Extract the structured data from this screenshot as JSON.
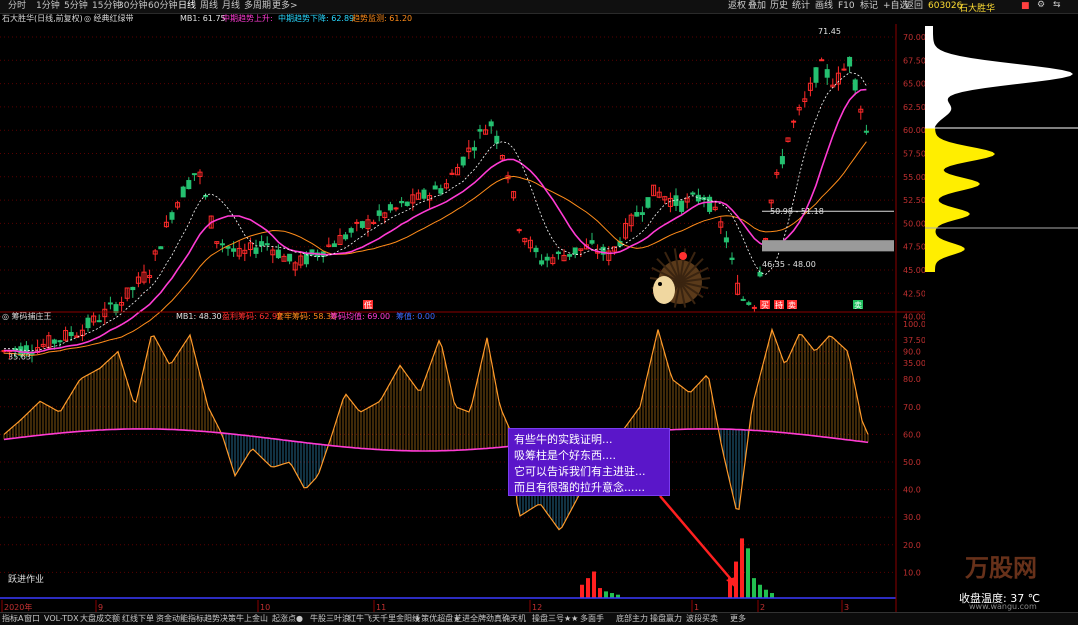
{
  "periods": [
    "分时",
    "1分钟",
    "5分钟",
    "15分钟",
    "30分钟",
    "60分钟",
    "日线",
    "周线",
    "月线",
    "多周期",
    "更多>"
  ],
  "active_period": "日线",
  "right_buttons": [
    "返权",
    "叠加",
    "历史",
    "统计",
    "画线",
    "F10",
    "标记",
    "+自选",
    "返回"
  ],
  "header": {
    "stock": "石大胜华(日线,前复权)",
    "indicator": "◎ 经典红绿带",
    "ma1": "MB1: 61.75",
    "up_trend": "中期趋势上升: ",
    "down_trend": "中期趋势下降: 62.89",
    "trend_watch": "趋势监测: 61.20"
  },
  "price_axis": [
    "70.00",
    "67.50",
    "65.00",
    "62.50",
    "60.00",
    "57.50",
    "55.00",
    "52.50",
    "50.00",
    "47.50",
    "45.00",
    "42.50",
    "40.00",
    "37.50",
    "35.00"
  ],
  "price_labels": {
    "high": "71.45",
    "low": "35.63",
    "chip_upper": "50.98 - 51.18",
    "chip_lower": "46.35 - 48.00"
  },
  "signals": {
    "buy": "买",
    "sell": "卖",
    "hold": "持",
    "low_mark": "低"
  },
  "sub_header": {
    "name": "◎ 筹码捕庄王",
    "mb1": "MB1: 48.30",
    "profit": "盈利筹码: 62.92",
    "chase": "套牢筹码: 58.30",
    "avg": "筹码均值: 69.00",
    "extra": "筹值: 0.00"
  },
  "sub_axis": [
    "100.0",
    "90.0",
    "80.0",
    "70.0",
    "60.0",
    "50.0",
    "40.0",
    "30.0",
    "20.0",
    "10.0"
  ],
  "sub_note": "跃进作业",
  "callout_lines": [
    "有些牛的实践证明...",
    "吸筹柱是个好东西....",
    "它可以告诉我们有主进驻...",
    "而且有很强的拉升意念......"
  ],
  "date_axis": [
    "2020年",
    "9",
    "10",
    "11",
    "12",
    "1",
    "2",
    "3"
  ],
  "tabs": [
    "指标A",
    "窗口",
    "VOL-TDX",
    "大盘成交额",
    "红线下单",
    "资金动能指标",
    "趋势决策",
    "牛上金山",
    "起涨点●",
    "牛股三叶浪",
    "红牛飞天",
    "千里金阳线",
    "★策优超盘★",
    "芝进全牌劲",
    "真确天机",
    "操盘三号★★",
    "多面手",
    "底部主力",
    "操盘赢力",
    "波段买卖",
    "更多"
  ],
  "right_pane": {
    "code": "603026",
    "name": "石大胜华",
    "temp_label": "收盘温度: 37 ℃",
    "watermark": "万股网",
    "site": "www.wangu.com",
    "colors": {
      "chip_yellow": "#ffee00",
      "chip_white": "#ffffff"
    }
  }
}
